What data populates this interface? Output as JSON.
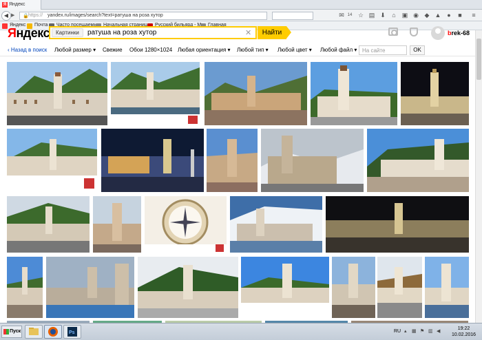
{
  "browser": {
    "tab_title": "Яндекс",
    "url_scheme": "https://",
    "url_rest": "yandex.ru/images/search?text=ратуша на роза хутор",
    "notification_count": "14"
  },
  "bookmarks": [
    {
      "label": "Яндекс",
      "icon": "yandex-icon",
      "color": "#f33"
    },
    {
      "label": "Почта",
      "icon": "mail-icon",
      "color": "#f5b800"
    },
    {
      "label": "Часто посещаемые",
      "icon": "bookmark-icon",
      "color": "#666"
    },
    {
      "label": "Начальная страница",
      "icon": "page-icon",
      "color": "#888"
    },
    {
      "label": "Русский бильярд - М...",
      "icon": "billiard-icon",
      "color": "#c00"
    },
    {
      "label": "Главная",
      "icon": "page-icon",
      "color": "#888"
    }
  ],
  "header": {
    "logo_first": "Я",
    "logo_rest": "ндекс",
    "category": "Картинки",
    "query": "ратуша на роза хутор",
    "find_label": "Найти",
    "user_first": "b",
    "user_rest": "rek-68"
  },
  "filters": {
    "back": "‹  Назад в поиск",
    "size": "Любой размер",
    "fresh": "Свежие",
    "wallpaper": "Обои 1280×1024",
    "orientation": "Любая ориентация",
    "type": "Любой тип",
    "color": "Любой цвет",
    "file": "Любой файл",
    "site_placeholder": "На сайте",
    "ok": "OK"
  },
  "taskbar": {
    "start": "Пуск",
    "lang": "RU",
    "time": "19:22",
    "date": "10.02.2016"
  },
  "colors": {
    "brand_red": "#ff0000",
    "search_yellow": "#ffcc00",
    "link_blue": "#0044bb"
  }
}
